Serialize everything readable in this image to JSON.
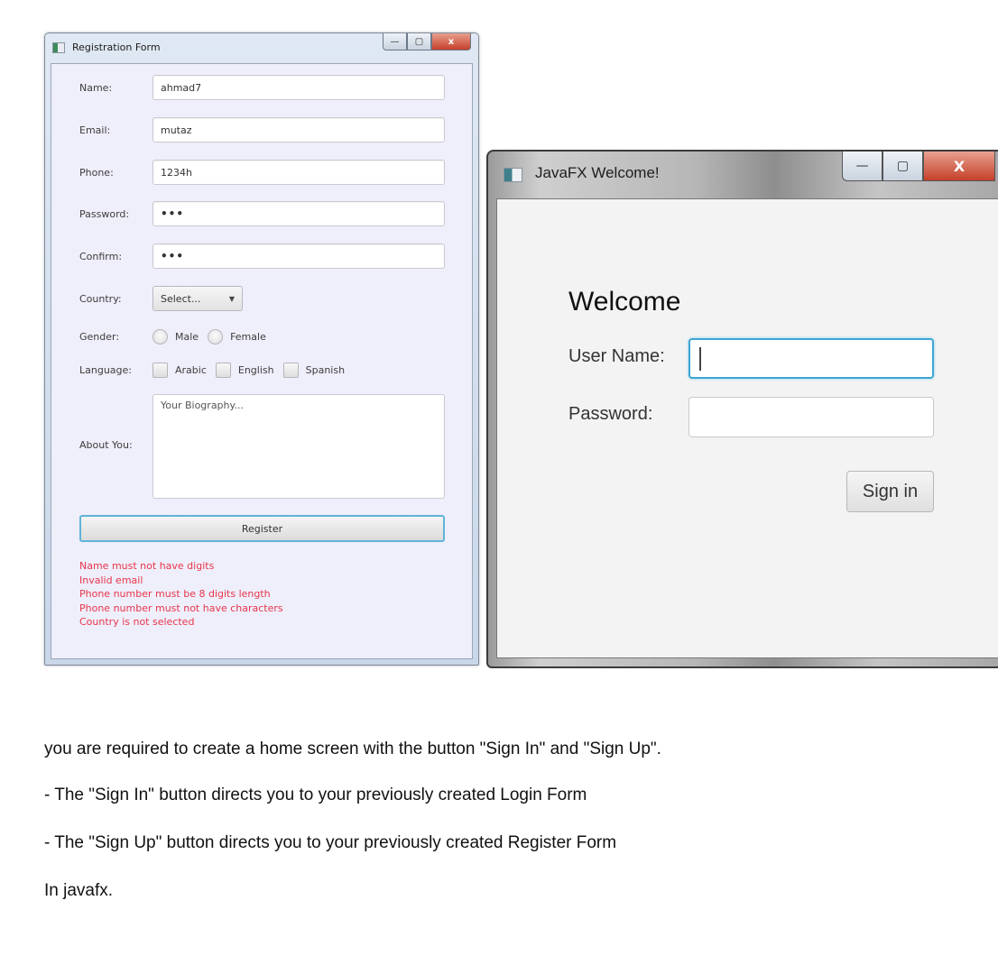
{
  "registration_window": {
    "title": "Registration Form",
    "window_controls": {
      "minimize": "—",
      "maximize": "▢",
      "close": "x"
    },
    "fields": {
      "name": {
        "label": "Name:",
        "value": "ahmad7"
      },
      "email": {
        "label": "Email:",
        "value": "mutaz"
      },
      "phone": {
        "label": "Phone:",
        "value": "1234h"
      },
      "password": {
        "label": "Password:",
        "value": "•••"
      },
      "confirm": {
        "label": "Confirm:",
        "value": "•••"
      }
    },
    "country": {
      "label": "Country:",
      "selected": "Select...",
      "arrow": "▼"
    },
    "gender": {
      "label": "Gender:",
      "options": [
        "Male",
        "Female"
      ]
    },
    "language": {
      "label": "Language:",
      "options": [
        "Arabic",
        "English",
        "Spanish"
      ]
    },
    "about": {
      "label": "About You:",
      "placeholder": "Your Biography..."
    },
    "register_button": "Register",
    "errors": [
      "Name must not have digits",
      "Invalid email",
      "Phone number must be 8 digits length",
      "Phone number must not have characters",
      "Country is not selected"
    ],
    "error_color": "#e8364a"
  },
  "welcome_window": {
    "title": "JavaFX Welcome!",
    "window_controls": {
      "minimize": "—",
      "maximize": "▢",
      "close": "X"
    },
    "heading": "Welcome",
    "username_label": "User Name:",
    "username_value": "",
    "password_label": "Password:",
    "password_value": "",
    "signin_button": "Sign in",
    "focus_color": "#3ea5d1"
  },
  "instructions": [
    "you are required to create a home screen with the button \"Sign In\" and \"Sign Up\".",
    "- The \"Sign In\" button directs you to your previously created Login Form",
    "- The \"Sign Up\" button directs you to your previously created Register Form",
    "In javafx."
  ]
}
